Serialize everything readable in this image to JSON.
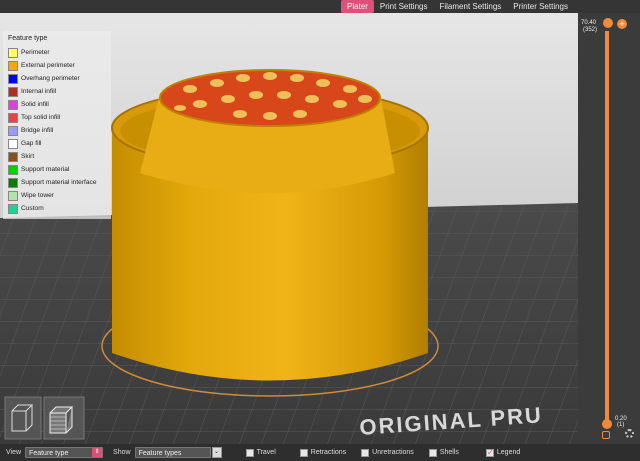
{
  "tabs": [
    {
      "label": "Plater",
      "active": true
    },
    {
      "label": "Print Settings",
      "active": false
    },
    {
      "label": "Filament Settings",
      "active": false
    },
    {
      "label": "Printer Settings",
      "active": false
    }
  ],
  "legend": {
    "title": "Feature type",
    "items": [
      {
        "label": "Perimeter",
        "color": "#ffff66"
      },
      {
        "label": "External perimeter",
        "color": "#ffa500"
      },
      {
        "label": "Overhang perimeter",
        "color": "#0000ff"
      },
      {
        "label": "Internal infill",
        "color": "#b03029"
      },
      {
        "label": "Solid infill",
        "color": "#d646d6"
      },
      {
        "label": "Top solid infill",
        "color": "#f04040"
      },
      {
        "label": "Bridge infill",
        "color": "#9999ff"
      },
      {
        "label": "Gap fill",
        "color": "#ffffff"
      },
      {
        "label": "Skirt",
        "color": "#845321"
      },
      {
        "label": "Support material",
        "color": "#00d000"
      },
      {
        "label": "Support material interface",
        "color": "#008000"
      },
      {
        "label": "Wipe tower",
        "color": "#b3e3ab"
      },
      {
        "label": "Custom",
        "color": "#28cc94"
      }
    ]
  },
  "layer_slider": {
    "top_value": "70.40",
    "top_layer": "(352)",
    "bottom_value": "0.20",
    "bottom_layer": "(1)"
  },
  "bed_label": "ORIGINAL PRU",
  "bottom_bar": {
    "view_label": "View",
    "view_value": "Feature type",
    "show_label": "Show",
    "show_value": "Feature types",
    "checkboxes": [
      {
        "label": "Travel",
        "checked": false
      },
      {
        "label": "Retractions",
        "checked": false
      },
      {
        "label": "Unretractions",
        "checked": false
      },
      {
        "label": "Shells",
        "checked": false
      },
      {
        "label": "Legend",
        "checked": true
      }
    ]
  }
}
